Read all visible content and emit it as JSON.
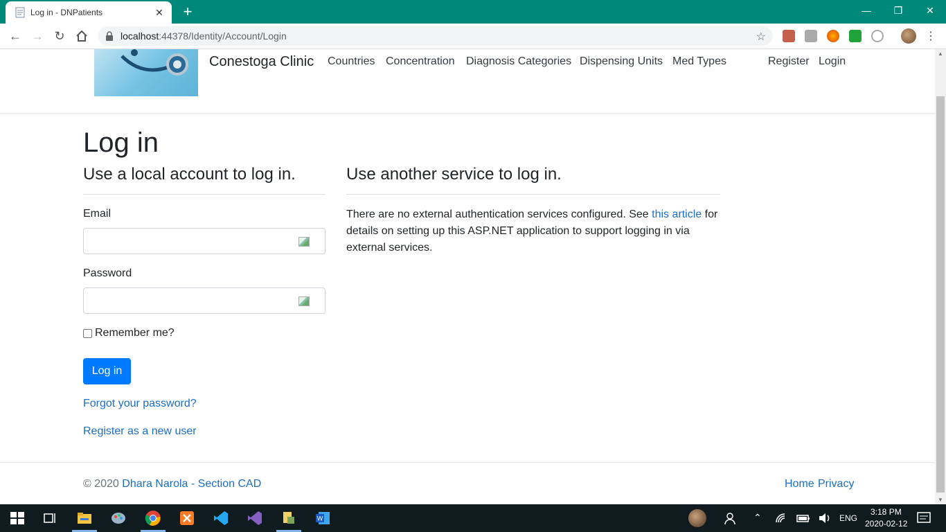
{
  "browser": {
    "tab_title": "Log in - DNPatients",
    "tab_close": "✕",
    "new_tab": "+",
    "url_host": "localhost",
    "url_path": ":44378/Identity/Account/Login",
    "win_minimize": "—",
    "win_restore": "❐",
    "win_close": "✕"
  },
  "header": {
    "brand": "Conestoga Clinic",
    "nav": [
      "Countries",
      "Concentration",
      "Diagnosis Categories",
      "Dispensing Units",
      "Med Types"
    ],
    "register": "Register",
    "login": "Login"
  },
  "main": {
    "page_title": "Log in",
    "local_title": "Use a local account to log in.",
    "service_title": "Use another service to log in.",
    "email_label": "Email",
    "password_label": "Password",
    "remember_label": "Remember me?",
    "login_button": "Log in",
    "forgot_link": "Forgot your password?",
    "register_link": "Register as a new user",
    "external_text_before": "There are no external authentication services configured. See ",
    "external_link": "this article",
    "external_text_after": " for details on setting up this ASP.NET application to support logging in via external services."
  },
  "footer": {
    "copyright_prefix": "© 2020 ",
    "author_link": "Dhara Narola - Section CAD",
    "home_link": "Home",
    "privacy_link": "Privacy"
  },
  "taskbar": {
    "time": "3:18 PM",
    "date": "2020-02-12",
    "lang": "ENG"
  },
  "colors": {
    "titlebar": "#00897b",
    "primary": "#007bff",
    "link": "#1b6ec2",
    "taskbar": "#0f1b1e"
  }
}
